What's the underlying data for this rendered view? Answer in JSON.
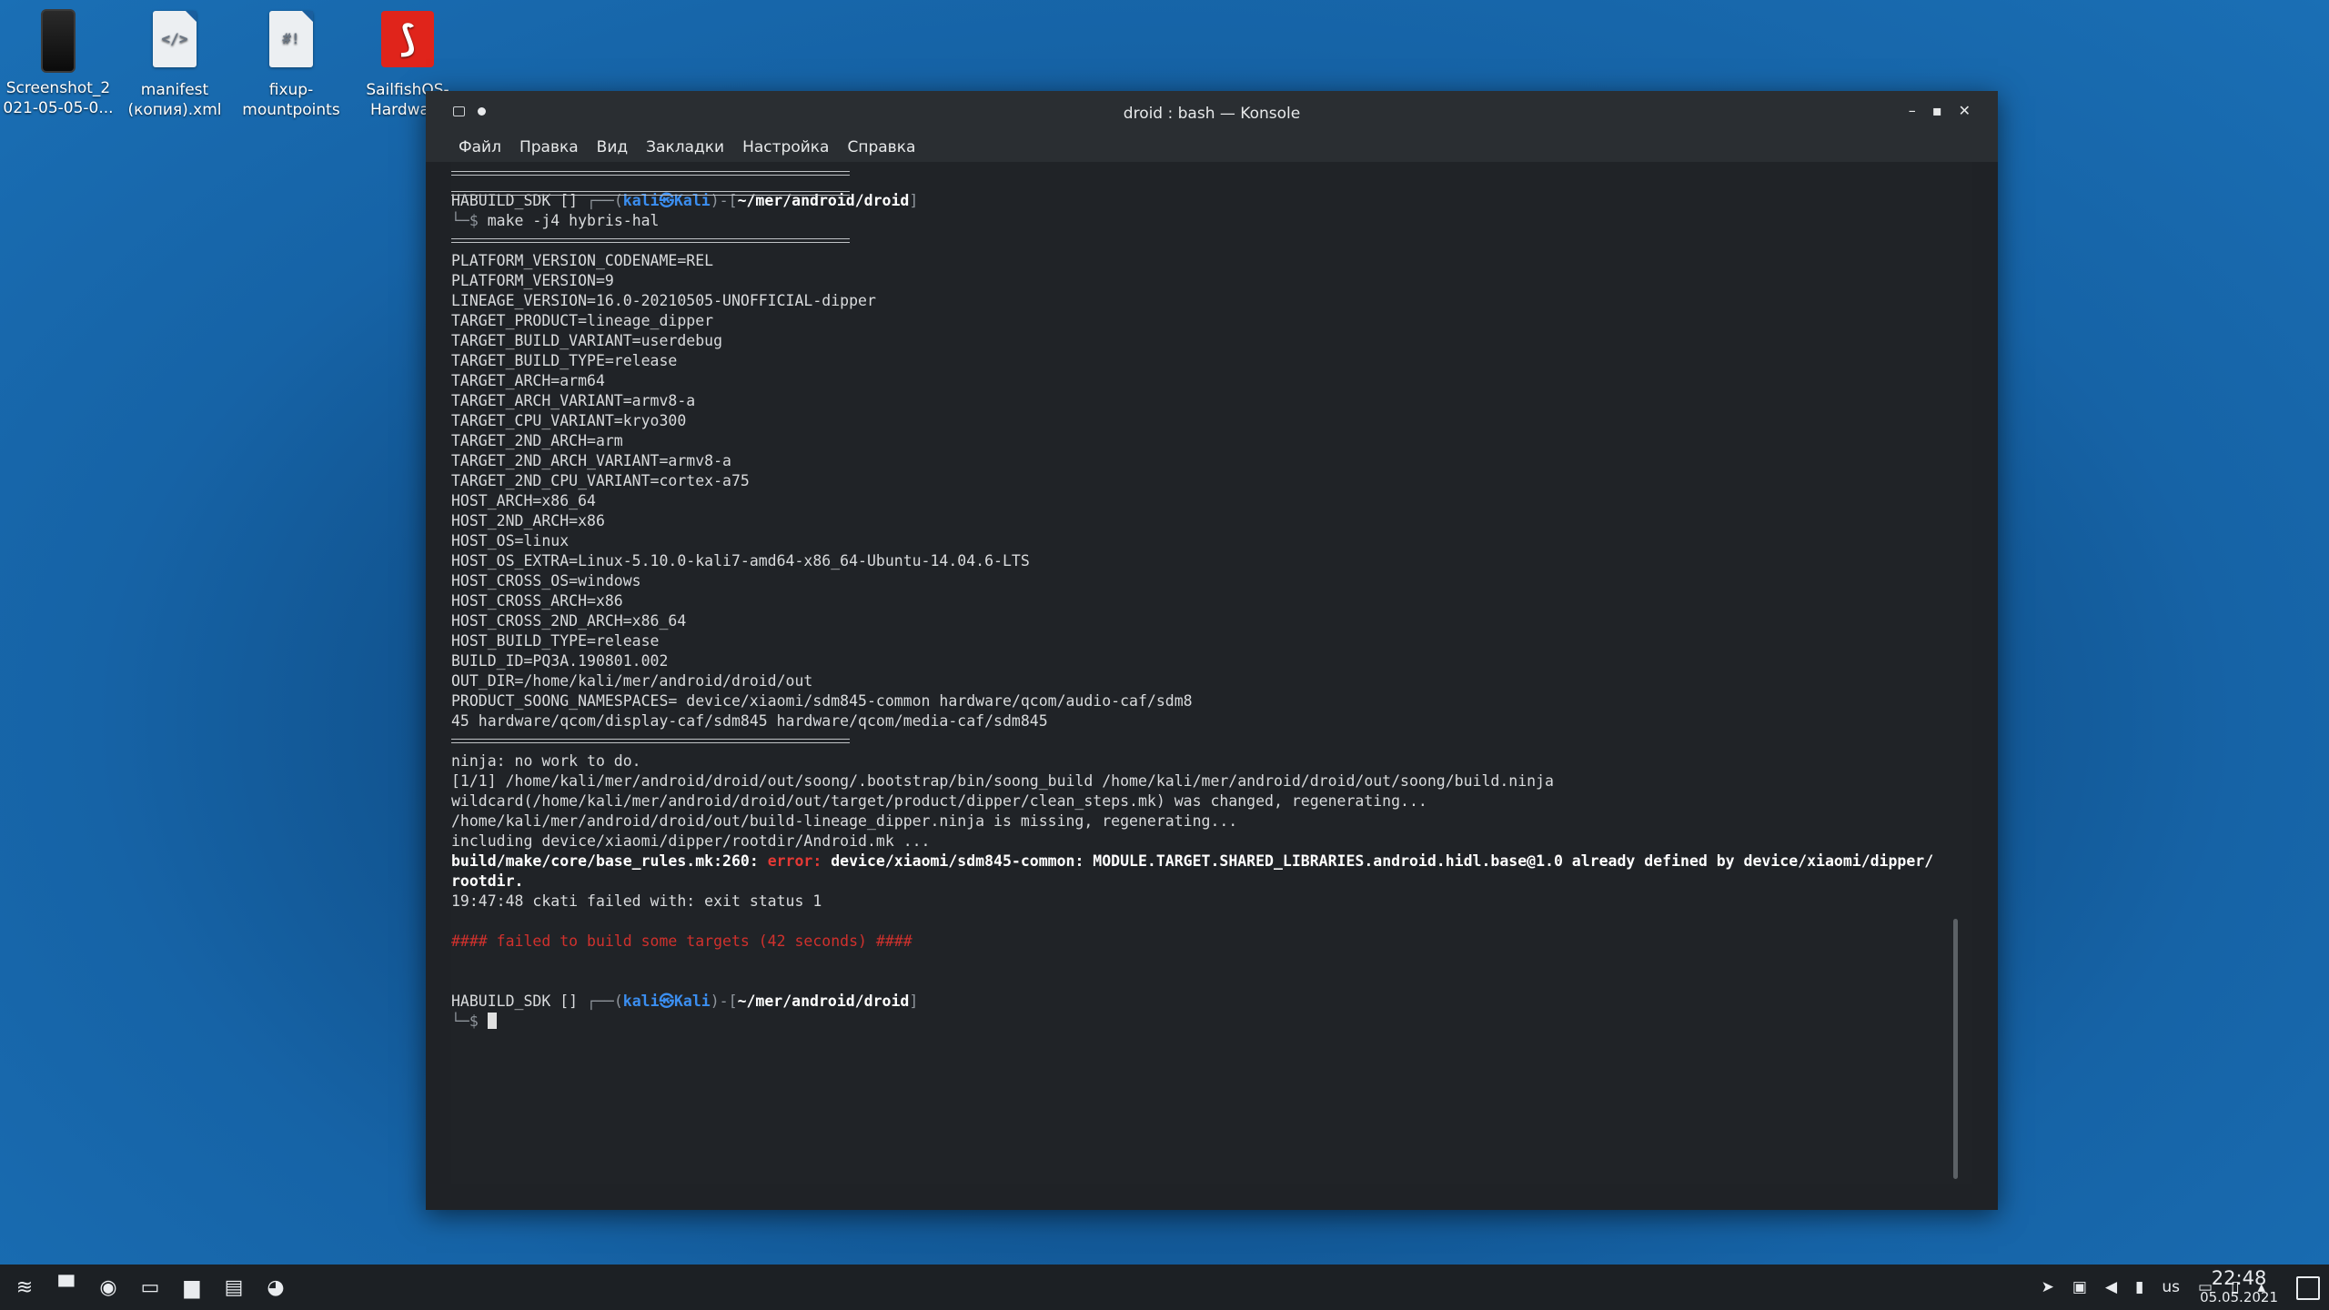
{
  "desktop": {
    "icons": [
      {
        "label": "Screenshot_2\n021-05-05-0...",
        "icon": "phone-screenshot-icon"
      },
      {
        "label": "manifest\n(копия).xml",
        "icon": "xml-file-icon",
        "glyph": "</>"
      },
      {
        "label": "fixup-\nmountpoints",
        "icon": "script-file-icon",
        "glyph": "#!"
      },
      {
        "label": "SailfishOS-\nHardware",
        "icon": "pdf-file-icon",
        "glyph": "Ā"
      }
    ]
  },
  "window": {
    "title": "droid : bash — Konsole",
    "controls": {
      "minimize": "–",
      "maximize": "▪",
      "close": "✕"
    },
    "menu": [
      "Файл",
      "Правка",
      "Вид",
      "Закладки",
      "Настройка",
      "Справка"
    ]
  },
  "terminal": {
    "prompt1": {
      "env": "HABUILD_SDK [] ",
      "box_open": "┌──(",
      "user": "kali㉿Kali",
      "mid": ")-[",
      "path": "~/mer/android/droid",
      "close": "]",
      "arrow": "└─$ ",
      "command": "make -j4 hybris-hal"
    },
    "config_lines": [
      "PLATFORM_VERSION_CODENAME=REL",
      "PLATFORM_VERSION=9",
      "LINEAGE_VERSION=16.0-20210505-UNOFFICIAL-dipper",
      "TARGET_PRODUCT=lineage_dipper",
      "TARGET_BUILD_VARIANT=userdebug",
      "TARGET_BUILD_TYPE=release",
      "TARGET_ARCH=arm64",
      "TARGET_ARCH_VARIANT=armv8-a",
      "TARGET_CPU_VARIANT=kryo300",
      "TARGET_2ND_ARCH=arm",
      "TARGET_2ND_ARCH_VARIANT=armv8-a",
      "TARGET_2ND_CPU_VARIANT=cortex-a75",
      "HOST_ARCH=x86_64",
      "HOST_2ND_ARCH=x86",
      "HOST_OS=linux",
      "HOST_OS_EXTRA=Linux-5.10.0-kali7-amd64-x86_64-Ubuntu-14.04.6-LTS",
      "HOST_CROSS_OS=windows",
      "HOST_CROSS_ARCH=x86",
      "HOST_CROSS_2ND_ARCH=x86_64",
      "HOST_BUILD_TYPE=release",
      "BUILD_ID=PQ3A.190801.002",
      "OUT_DIR=/home/kali/mer/android/droid/out",
      "PRODUCT_SOONG_NAMESPACES= device/xiaomi/sdm845-common hardware/qcom/audio-caf/sdm8",
      "45 hardware/qcom/display-caf/sdm845 hardware/qcom/media-caf/sdm845"
    ],
    "build_lines": [
      "ninja: no work to do.",
      "[1/1] /home/kali/mer/android/droid/out/soong/.bootstrap/bin/soong_build /home/kali/mer/android/droid/out/soong/build.ninja",
      "wildcard(/home/kali/mer/android/droid/out/target/product/dipper/clean_steps.mk) was changed, regenerating...",
      "/home/kali/mer/android/droid/out/build-lineage_dipper.ninja is missing, regenerating...",
      "including device/xiaomi/dipper/rootdir/Android.mk ..."
    ],
    "error": {
      "location": "build/make/core/base_rules.mk:260: ",
      "label": "error:",
      "message": " device/xiaomi/sdm845-common: MODULE.TARGET.SHARED_LIBRARIES.android.hidl.base@1.0 already defined by device/xiaomi/dipper/",
      "message2": "rootdir."
    },
    "ckati": "19:47:48 ckati failed with: exit status 1",
    "failed": "#### failed to build some targets (42 seconds) ####",
    "prompt2": {
      "env": "HABUILD_SDK [] ",
      "box_open": "┌──(",
      "user": "kali㉿Kali",
      "mid": ")-[",
      "path": "~/mer/android/droid",
      "close": "]",
      "arrow": "└─$ "
    }
  },
  "taskbar": {
    "apps": [
      {
        "name": "kali-menu-icon",
        "glyph": "≋"
      },
      {
        "name": "show-desktop-app-icon",
        "glyph": "▀"
      },
      {
        "name": "chromium-icon",
        "glyph": "◉"
      },
      {
        "name": "konsole-icon",
        "glyph": "▭"
      },
      {
        "name": "file-manager-icon",
        "glyph": "▆"
      },
      {
        "name": "pdf-viewer-icon",
        "glyph": "▤"
      },
      {
        "name": "telegram-icon",
        "glyph": "◕"
      }
    ],
    "tray": {
      "keyboard_layout": "us"
    },
    "clock": {
      "time": "22:48",
      "date": "05.05.2021"
    }
  },
  "colors": {
    "accent_blue": "#3b8ef0",
    "error_red": "#e53935",
    "terminal_bg": "#202327"
  }
}
